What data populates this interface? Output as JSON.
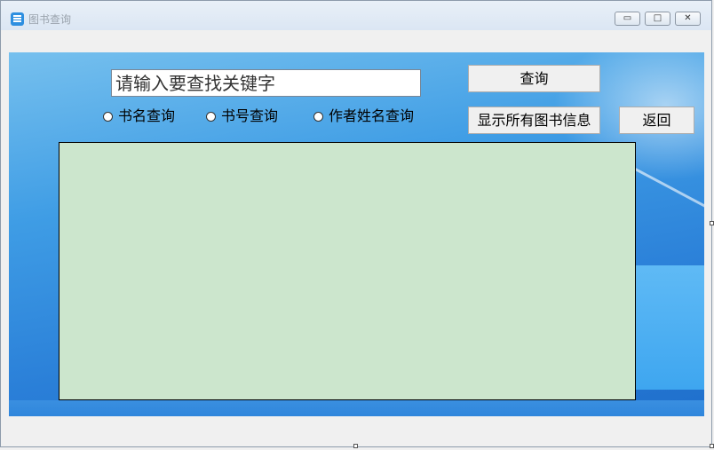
{
  "window": {
    "title": "图书查询",
    "controls": {
      "minimize": "▭",
      "maximize": "□",
      "close": "✕"
    }
  },
  "search": {
    "placeholder": "请输入要查找关键字",
    "query_button": "查询",
    "show_all_button": "显示所有图书信息",
    "back_button": "返回"
  },
  "search_mode": {
    "options": [
      "书名查询",
      "书号查询",
      "作者姓名查询"
    ],
    "selected": null
  },
  "colors": {
    "background_gradient_start": "#76c0ee",
    "background_gradient_end": "#1f6fcc",
    "results_panel": "#cce6cd",
    "button_face": "#f0f0f0"
  },
  "icons": {
    "app": "book-list-icon",
    "minimize": "minimize-icon",
    "maximize": "maximize-icon",
    "close": "close-icon"
  }
}
